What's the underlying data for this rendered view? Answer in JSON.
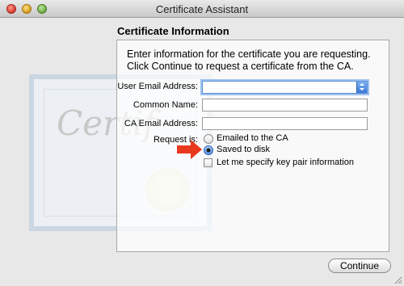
{
  "window": {
    "title": "Certificate Assistant"
  },
  "section": {
    "title": "Certificate Information"
  },
  "intro": {
    "line1": "Enter information for the certificate you are requesting.",
    "line2": "Click Continue to request a certificate from the CA."
  },
  "form": {
    "user_email_label": "User Email Address:",
    "user_email_value": "",
    "common_name_label": "Common Name:",
    "common_name_value": "",
    "ca_email_label": "CA Email Address:",
    "ca_email_value": "",
    "request_label": "Request is:",
    "options": [
      {
        "label": "Emailed to the CA",
        "selected": false
      },
      {
        "label": "Saved to disk",
        "selected": true
      }
    ],
    "key_pair_label": "Let me specify key pair information",
    "key_pair_checked": false
  },
  "background_art": {
    "word": "Certif"
  },
  "footer": {
    "continue_label": "Continue"
  },
  "colors": {
    "arrow": "#e8391e",
    "focus": "#9ec1ef"
  }
}
